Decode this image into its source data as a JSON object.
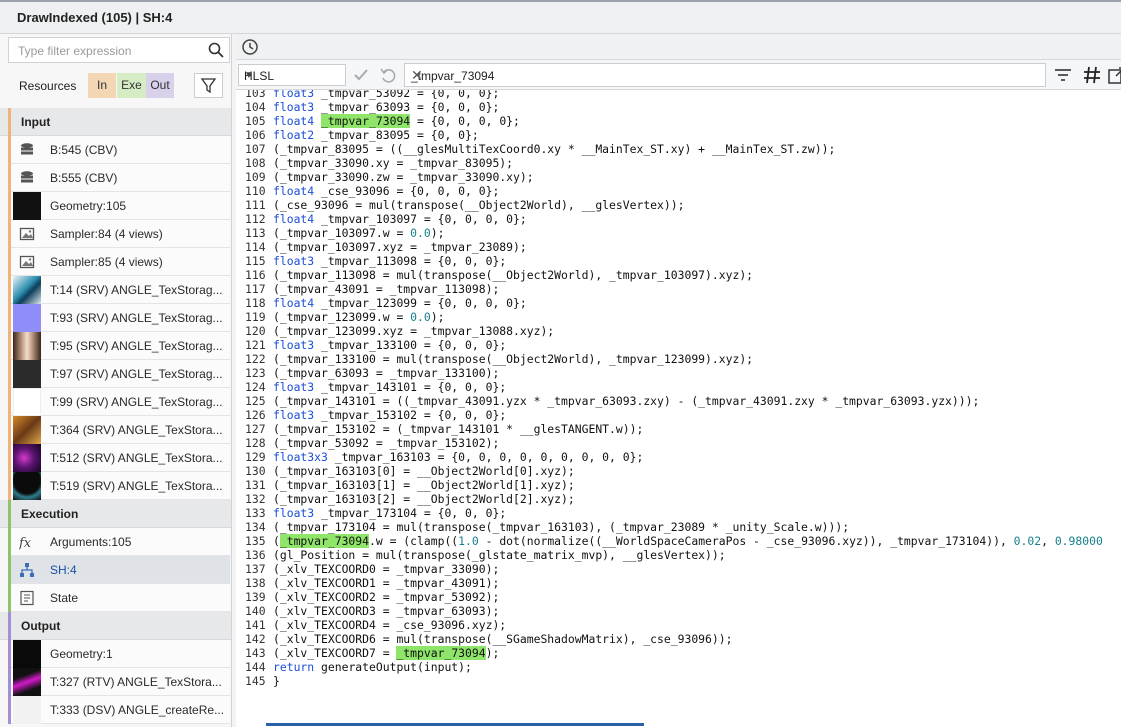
{
  "window": {
    "title": "DrawIndexed (105) | SH:4"
  },
  "left": {
    "filter_placeholder": "Type filter expression",
    "resources_label": "Resources",
    "tabs": {
      "in": "In",
      "exe": "Exe",
      "out": "Out"
    },
    "sections": {
      "input": "Input",
      "execution": "Execution",
      "output": "Output"
    },
    "input_items": [
      {
        "label": "B:545 (CBV)",
        "icon": "buffer-icon"
      },
      {
        "label": "B:555 (CBV)",
        "icon": "buffer-icon"
      },
      {
        "label": "Geometry:105",
        "icon": "geometry-thumbnail"
      },
      {
        "label": "Sampler:84 (4 views)",
        "icon": "sampler-icon"
      },
      {
        "label": "Sampler:85 (4 views)",
        "icon": "sampler-icon"
      },
      {
        "label": "T:14 (SRV) ANGLE_TexStorag...",
        "icon": "texture-thumbnail"
      },
      {
        "label": "T:93 (SRV) ANGLE_TexStorag...",
        "icon": "texture-thumbnail"
      },
      {
        "label": "T:95 (SRV) ANGLE_TexStorag...",
        "icon": "texture-thumbnail"
      },
      {
        "label": "T:97 (SRV) ANGLE_TexStorag...",
        "icon": "texture-thumbnail"
      },
      {
        "label": "T:99 (SRV) ANGLE_TexStorag...",
        "icon": "texture-thumbnail"
      },
      {
        "label": "T:364 (SRV) ANGLE_TexStora...",
        "icon": "texture-thumbnail"
      },
      {
        "label": "T:512 (SRV) ANGLE_TexStora...",
        "icon": "texture-thumbnail"
      },
      {
        "label": "T:519 (SRV) ANGLE_TexStora...",
        "icon": "texture-thumbnail"
      }
    ],
    "execution_items": [
      {
        "label": "Arguments:105",
        "icon": "function-icon"
      },
      {
        "label": "SH:4",
        "icon": "shader-icon"
      },
      {
        "label": "State",
        "icon": "state-icon"
      }
    ],
    "output_items": [
      {
        "label": "Geometry:1",
        "icon": "geometry-thumbnail"
      },
      {
        "label": "T:327 (RTV) ANGLE_TexStora...",
        "icon": "texture-thumbnail"
      },
      {
        "label": "T:333 (DSV) ANGLE_createRe...",
        "icon": "texture-thumbnail"
      }
    ]
  },
  "toolbar": {
    "language": "HLSL",
    "search_value": "_tmpvar_73094"
  },
  "colors": {
    "keyword": "#1c4ed8",
    "number": "#17808c",
    "highlight": "#8fe56a",
    "input_accent": "#f0b47a",
    "execution_accent": "#8cc46a",
    "output_accent": "#a48fd6"
  },
  "code": [
    "103|float3 _tmpvar_53092 = {0, 0, 0};",
    "104|float3 _tmpvar_63093 = {0, 0, 0};",
    "105|float4 _tmpvar_73094 = {0, 0, 0, 0};",
    "106|float2 _tmpvar_83095 = {0, 0};",
    "107|(_tmpvar_83095 = ((__glesMultiTexCoord0.xy * __MainTex_ST.xy) + __MainTex_ST.zw));",
    "108|(_tmpvar_33090.xy = _tmpvar_83095);",
    "109|(_tmpvar_33090.zw = _tmpvar_33090.xy);",
    "110|float4 _cse_93096 = {0, 0, 0, 0};",
    "111|(_cse_93096 = mul(transpose(__Object2World), __glesVertex));",
    "112|float4 _tmpvar_103097 = {0, 0, 0, 0};",
    "113|(_tmpvar_103097.w = 0.0);",
    "114|(_tmpvar_103097.xyz = _tmpvar_23089);",
    "115|float3 _tmpvar_113098 = {0, 0, 0};",
    "116|(_tmpvar_113098 = mul(transpose(__Object2World), _tmpvar_103097).xyz);",
    "117|(_tmpvar_43091 = _tmpvar_113098);",
    "118|float4 _tmpvar_123099 = {0, 0, 0, 0};",
    "119|(_tmpvar_123099.w = 0.0);",
    "120|(_tmpvar_123099.xyz = _tmpvar_13088.xyz);",
    "121|float3 _tmpvar_133100 = {0, 0, 0};",
    "122|(_tmpvar_133100 = mul(transpose(__Object2World), _tmpvar_123099).xyz);",
    "123|(_tmpvar_63093 = _tmpvar_133100);",
    "124|float3 _tmpvar_143101 = {0, 0, 0};",
    "125|(_tmpvar_143101 = ((_tmpvar_43091.yzx * _tmpvar_63093.zxy) - (_tmpvar_43091.zxy * _tmpvar_63093.yzx)));",
    "126|float3 _tmpvar_153102 = {0, 0, 0};",
    "127|(_tmpvar_153102 = (_tmpvar_143101 * __glesTANGENT.w));",
    "128|(_tmpvar_53092 = _tmpvar_153102);",
    "129|float3x3 _tmpvar_163103 = {0, 0, 0, 0, 0, 0, 0, 0, 0};",
    "130|(_tmpvar_163103[0] = __Object2World[0].xyz);",
    "131|(_tmpvar_163103[1] = __Object2World[1].xyz);",
    "132|(_tmpvar_163103[2] = __Object2World[2].xyz);",
    "133|float3 _tmpvar_173104 = {0, 0, 0};",
    "134|(_tmpvar_173104 = mul(transpose(_tmpvar_163103), (_tmpvar_23089 * _unity_Scale.w)));",
    "135|(_tmpvar_73094.w = (clamp((1.0 - dot(normalize((__WorldSpaceCameraPos - _cse_93096.xyz)), _tmpvar_173104)), 0.02, 0.98000",
    "136|(gl_Position = mul(transpose(_glstate_matrix_mvp), __glesVertex));",
    "137|(_xlv_TEXCOORD0 = _tmpvar_33090);",
    "138|(_xlv_TEXCOORD1 = _tmpvar_43091);",
    "139|(_xlv_TEXCOORD2 = _tmpvar_53092);",
    "140|(_xlv_TEXCOORD3 = _tmpvar_63093);",
    "141|(_xlv_TEXCOORD4 = _cse_93096.xyz);",
    "142|(_xlv_TEXCOORD6 = mul(transpose(__SGameShadowMatrix), _cse_93096));",
    "143|(_xlv_TEXCOORD7 = _tmpvar_73094);",
    "144|return generateOutput(input);",
    "145|}"
  ]
}
